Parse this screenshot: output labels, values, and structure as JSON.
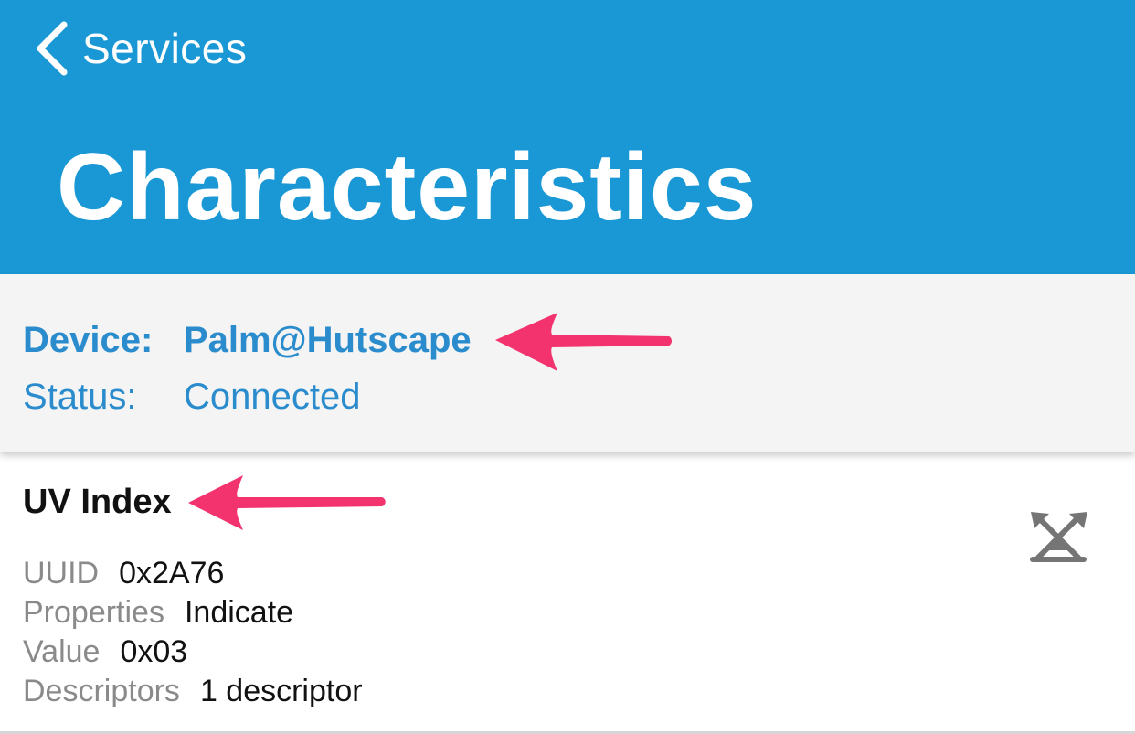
{
  "nav": {
    "back_label": "Services",
    "title": "Characteristics",
    "back_icon": "chevron-left-icon",
    "color": "#1a98d5"
  },
  "device_info": {
    "device_label": "Device:",
    "device_name": "Palm@Hutscape",
    "status_label": "Status:",
    "status_value": "Connected",
    "accent_color": "#2a8ccd"
  },
  "characteristic": {
    "name": "UV Index",
    "uuid_label": "UUID",
    "uuid_value": "0x2A76",
    "properties_label": "Properties",
    "properties_value": "Indicate",
    "value_label": "Value",
    "value_value": "0x03",
    "descriptors_label": "Descriptors",
    "descriptors_value": "1 descriptor",
    "action_icon": "notify-toggle-icon"
  },
  "annotations": {
    "arrow_color": "#f2336e",
    "arrow_icon": "left-arrow-icon"
  }
}
